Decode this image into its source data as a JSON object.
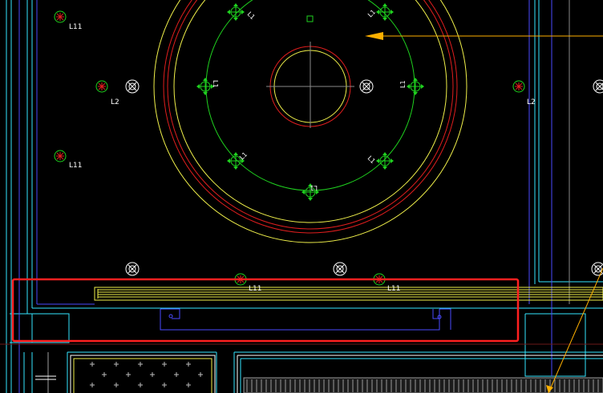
{
  "colors": {
    "background": "#000000",
    "cyan": "#33e6ff",
    "blue": "#4a4aff",
    "green": "#1fd21f",
    "yellow": "#f0f04a",
    "red": "#e01e1e",
    "white": "#ffffff",
    "orange": "#ffb000",
    "gray": "#8a8a8a",
    "selection": "#ff2020"
  },
  "labels": {
    "light_top_left": "L11",
    "light_left_mid": "L2",
    "light_left_low": "L11",
    "light_right_mid": "L2",
    "light_bottom_1": "L11",
    "light_bottom_2": "L11"
  },
  "ring_tags": {
    "top_left": "L1",
    "top_right": "L1",
    "left": "L1",
    "right": "L1",
    "bottom_left": "L1",
    "bottom_right": "L1",
    "bottom": "L1"
  },
  "icons": {
    "light_fixture": "circle-cross-light-icon",
    "downlight": "circle-x-downlight-icon",
    "ring_fixture": "diamond-cross-fixture-icon",
    "arrow": "orange-arrow-icon"
  },
  "selection": {
    "label": "highlighted-region"
  }
}
